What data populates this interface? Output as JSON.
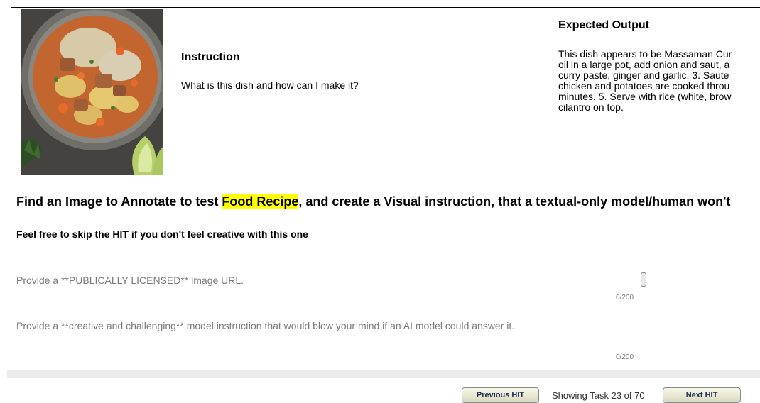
{
  "image": {
    "alt": "food dish photo",
    "subject": "Massaman curry with chicken, potatoes, carrots, rice and lime"
  },
  "instruction": {
    "heading": "Instruction",
    "text": "What is this dish and how can I make it?"
  },
  "expected_output": {
    "heading": "Expected Output",
    "lines": [
      "This dish appears to be Massaman Cur",
      "oil in a large pot, add onion and saut, a",
      "curry paste, ginger and garlic. 3. Saute",
      "chicken and potatoes are cooked throu",
      "minutes. 5. Serve with rice (white, brow",
      "cilantro on top."
    ]
  },
  "task": {
    "title_before": "Find an Image to Annotate to test ",
    "title_highlight": "Food Recipe",
    "title_after": ", and create a Visual instruction, that a textual-only model/human won't",
    "subtitle": "Feel free to skip the HIT if you don't feel creative with this one"
  },
  "form": {
    "url_placeholder": "Provide a **PUBLICALLY LICENSED** image URL.",
    "url_counter": "0/200",
    "instruction_placeholder": "Provide a **creative and challenging** model instruction that would blow your mind if an AI model could answer it.",
    "instruction_counter": "0/200"
  },
  "footer": {
    "prev_label": "Previous HIT",
    "status": "Showing Task 23 of 70",
    "next_label": "Next HIT"
  },
  "colors": {
    "highlight": "#ffff00",
    "button_text": "#1f2a55"
  }
}
